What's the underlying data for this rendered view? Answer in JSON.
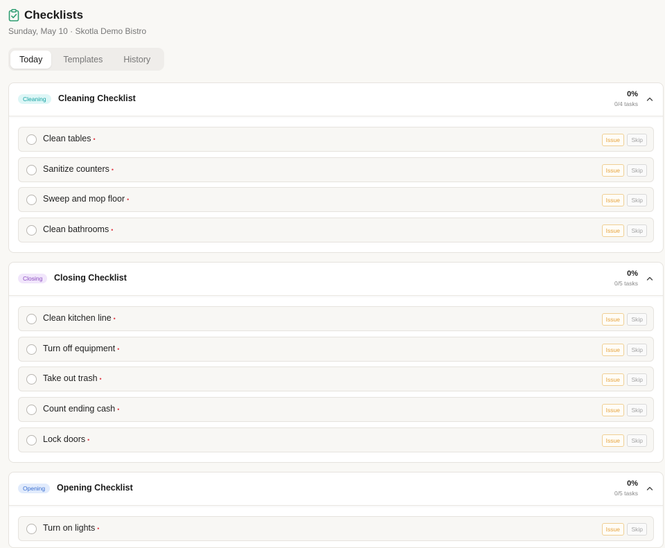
{
  "header": {
    "title": "Checklists",
    "subtitle": "Sunday, May 10 · Skotla Demo Bistro",
    "icon": "clipboard-check-icon",
    "icon_color": "#2f9e72"
  },
  "tabs": [
    {
      "label": "Today",
      "active": true
    },
    {
      "label": "Templates",
      "active": false
    },
    {
      "label": "History",
      "active": false
    }
  ],
  "checklists": [
    {
      "badge": "Cleaning",
      "badge_color": "#16a3a3",
      "badge_bg": "#ddf6f6",
      "title": "Cleaning Checklist",
      "progress": "0%",
      "tasks_count": "0/4 tasks",
      "items": [
        {
          "label": "Clean tables",
          "required_marker": "•"
        },
        {
          "label": "Sanitize counters",
          "required_marker": "•"
        },
        {
          "label": "Sweep and mop floor",
          "required_marker": "•"
        },
        {
          "label": "Clean bathrooms",
          "required_marker": "•"
        }
      ]
    },
    {
      "badge": "Closing",
      "badge_color": "#8a4cc0",
      "badge_bg": "#f1e6fb",
      "title": "Closing Checklist",
      "progress": "0%",
      "tasks_count": "0/5 tasks",
      "items": [
        {
          "label": "Clean kitchen line",
          "required_marker": "•"
        },
        {
          "label": "Turn off equipment",
          "required_marker": "•"
        },
        {
          "label": "Take out trash",
          "required_marker": "•"
        },
        {
          "label": "Count ending cash",
          "required_marker": "•"
        },
        {
          "label": "Lock doors",
          "required_marker": "•"
        }
      ]
    },
    {
      "badge": "Opening",
      "badge_color": "#3a6fd1",
      "badge_bg": "#e1ebfc",
      "title": "Opening Checklist",
      "progress": "0%",
      "tasks_count": "0/5 tasks",
      "items": [
        {
          "label": "Turn on lights",
          "required_marker": "•"
        }
      ]
    }
  ],
  "actions": {
    "issue_label": "Issue",
    "skip_label": "Skip"
  }
}
